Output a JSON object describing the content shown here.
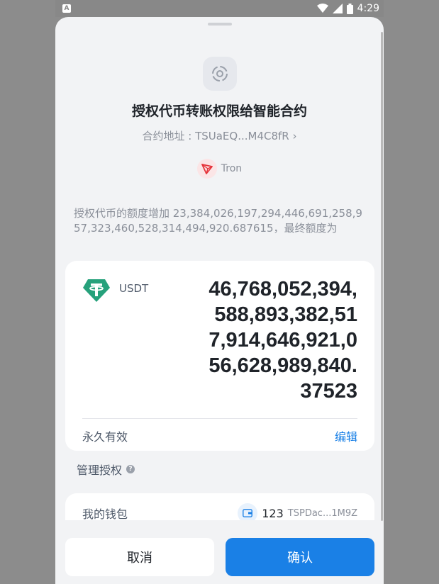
{
  "status_bar": {
    "time": "4:29",
    "notif_glyph": "A"
  },
  "colors": {
    "accent": "#1a80e6",
    "sheet_bg": "#f2f3f5",
    "tron_red": "#e5343b",
    "usdt_green": "#26a17b"
  },
  "header": {
    "title": "授权代币转账权限给智能合约",
    "contract_address": "合约地址 : TSUaEQ...M4C8fR",
    "chevron": "›",
    "chain_name": "Tron"
  },
  "description": "授权代币的额度增加 23,384,026,197,294,446,691,258,957,323,460,528,314,494,920.687615，最终额度为",
  "token": {
    "symbol": "USDT",
    "amount": "46,768,052,394,588,893,382,517,914,646,921,056,628,989,840.37523"
  },
  "validity": {
    "label": "永久有效",
    "edit_label": "编辑"
  },
  "manage": {
    "label": "管理授权",
    "help_glyph": "?"
  },
  "wallet": {
    "label": "我的钱包",
    "name": "123",
    "address": "TSPDac...1M9Z"
  },
  "buttons": {
    "cancel": "取消",
    "confirm": "确认"
  },
  "icons": [
    "notification-icon",
    "wifi-icon",
    "signal-icon",
    "battery-icon",
    "contract-icon",
    "tron-icon",
    "usdt-icon",
    "help-icon",
    "wallet-icon"
  ]
}
